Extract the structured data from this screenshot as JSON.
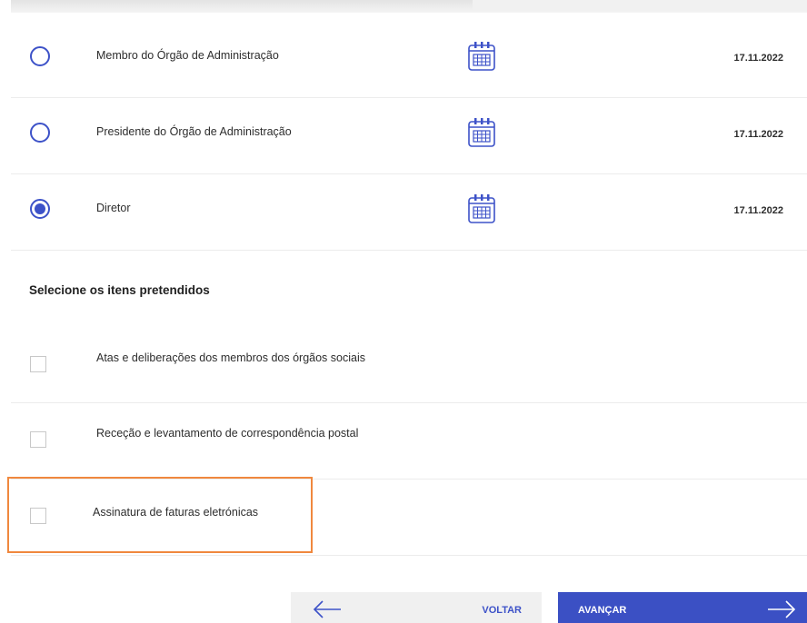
{
  "roles": [
    {
      "label": "Membro do Órgão de Administração",
      "date": "17.11.2022",
      "selected": false
    },
    {
      "label": "Presidente do Órgão de Administração",
      "date": "17.11.2022",
      "selected": false
    },
    {
      "label": "Diretor",
      "date": "17.11.2022",
      "selected": true
    }
  ],
  "items_section": {
    "title": "Selecione os itens pretendidos",
    "items": [
      {
        "label": "Atas e deliberações dos membros dos órgãos sociais",
        "checked": false
      },
      {
        "label": "Receção e levantamento de correspondência postal",
        "checked": false
      },
      {
        "label": "Assinatura de faturas eletrónicas",
        "checked": false
      }
    ]
  },
  "footer": {
    "back_label": "VOLTAR",
    "next_label": "AVANÇAR"
  },
  "icons": {
    "calendar": "calendar-icon",
    "back": "arrow-left-icon",
    "next": "arrow-right-icon"
  },
  "colors": {
    "accent": "#3b50c4",
    "highlight": "#f0883e"
  }
}
